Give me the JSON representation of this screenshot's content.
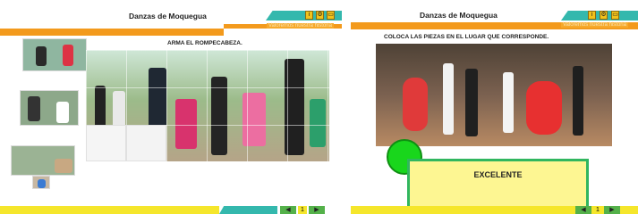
{
  "left_panel": {
    "title": "Danzas de Moquegua",
    "tagline": "Valoremos nuestra historia",
    "instruction": "ARMA EL ROMPECABEZA.",
    "nav": {
      "prev": "◀",
      "page": "1",
      "next": "▶"
    }
  },
  "right_panel": {
    "title": "Danzas de Moquegua",
    "tagline": "Valoremos nuestra historia",
    "instruction": "COLOCA LAS PIEZAS EN EL LUGAR QUE CORRESPONDE.",
    "feedback": "EXCELENTE",
    "nav": {
      "prev": "◀",
      "page": "1",
      "next": "▶"
    }
  },
  "toolbar_icons": [
    "info-icon",
    "settings-icon",
    "screen-icon"
  ],
  "colors": {
    "teal": "#34b8ad",
    "orange": "#f39a1c",
    "yellow": "#f5e62b",
    "green": "#19d61c",
    "feedback_bg": "#fdf692"
  }
}
